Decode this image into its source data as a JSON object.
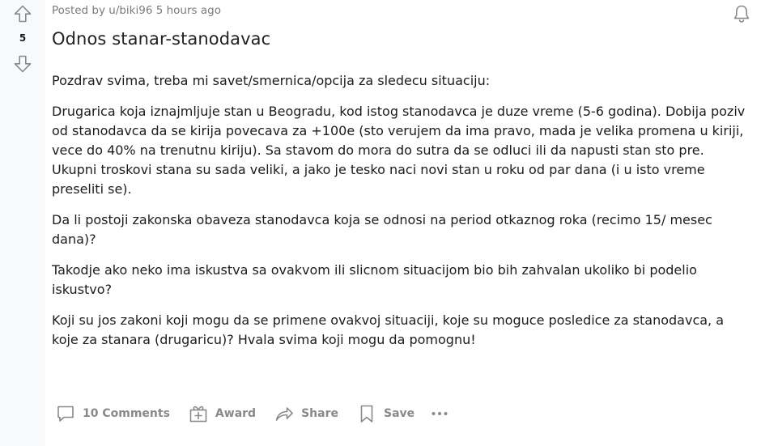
{
  "post": {
    "vote_count": "5",
    "posted_by": "Posted by u/biki96 5 hours ago",
    "title": "Odnos stanar-stanodavac",
    "paragraphs": [
      "Pozdrav svima, treba mi savet/smernica/opcija za sledecu situaciju:",
      "Drugarica koja iznajmljuje stan u Beogradu, kod istog stanodavca je duze vreme (5-6 godina). Dobija poziv od stanodavca da se kirija povecava za +100e (sto verujem da ima pravo, mada je velika promena u kiriji, vece do 40% na trenutnu kiriju). Sa stavom do mora do sutra da se odluci ili da napusti stan sto pre. Ukupni troskovi stana su sada veliki, a jako je tesko naci novi stan u roku od par dana (i u isto vreme preseliti se).",
      "Da li postoji zakonska obaveza stanodavca koja se odnosi na period otkaznog roka (recimo 15/ mesec dana)?",
      "Takodje ako neko ima iskustva sa ovakvom ili slicnom situacijom bio bih zahvalan ukoliko bi podelio iskustvo?",
      "Koji su jos zakoni koji mogu da se primene ovakvoj situaciji, koje su moguce posledice za stanodavca, a koje za stanara (drugaricu)? Hvala svima koji mogu da pomognu!"
    ]
  },
  "actions": {
    "comments_label": "10 Comments",
    "award_label": "Award",
    "share_label": "Share",
    "save_label": "Save"
  },
  "icons": {
    "upvote": "arrow-up-icon",
    "downvote": "arrow-down-icon",
    "notifications": "bell-icon",
    "comments": "comment-icon",
    "award": "gift-icon",
    "share": "share-icon",
    "save": "bookmark-icon",
    "more": "more-icon"
  },
  "colors": {
    "icon_gray": "#878a8c",
    "meta_gray": "#787c7e",
    "vote_column_bg": "#f8f9fa"
  }
}
